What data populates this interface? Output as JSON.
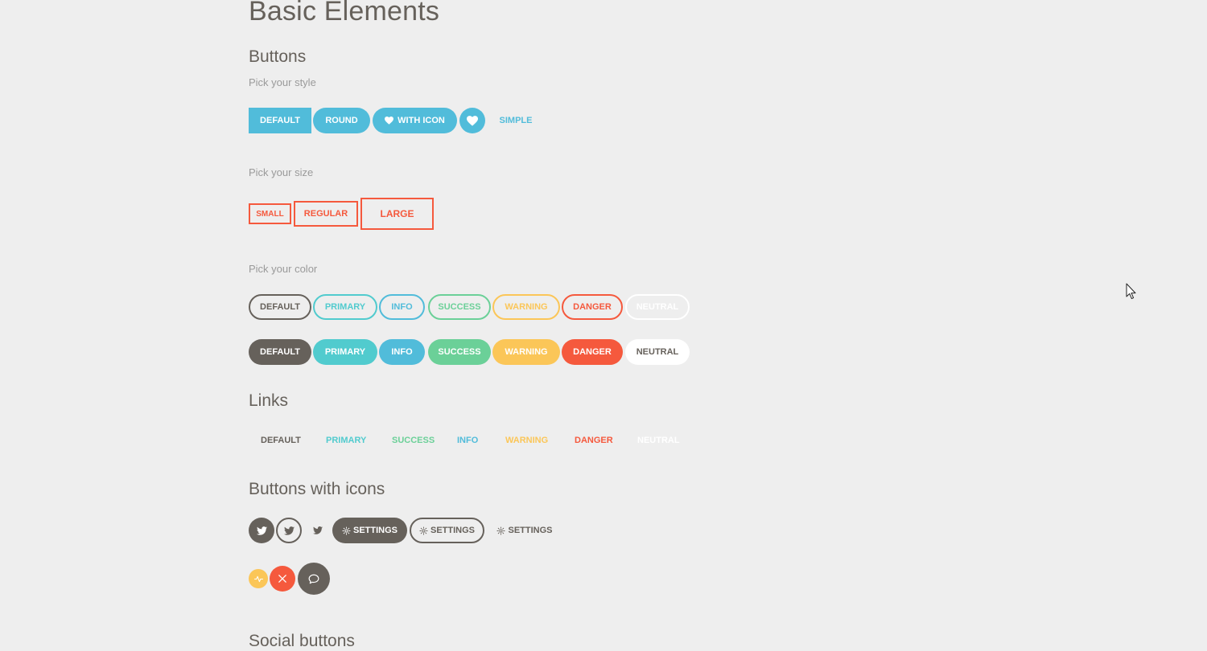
{
  "page_title": "Basic Elements",
  "buttons": {
    "heading": "Buttons",
    "style": {
      "label": "Pick your style",
      "default": "DEFAULT",
      "round": "ROUND",
      "with_icon": "WITH ICON",
      "simple": "SIMPLE"
    },
    "size": {
      "label": "Pick your size",
      "small": "SMALL",
      "regular": "REGULAR",
      "large": "LARGE"
    },
    "color": {
      "label": "Pick your color",
      "outline": [
        "DEFAULT",
        "PRIMARY",
        "INFO",
        "SUCCESS",
        "WARNING",
        "DANGER",
        "NEUTRAL"
      ],
      "filled": [
        "DEFAULT",
        "PRIMARY",
        "INFO",
        "SUCCESS",
        "WARNING",
        "DANGER",
        "NEUTRAL"
      ]
    }
  },
  "links": {
    "heading": "Links",
    "items": [
      "DEFAULT",
      "PRIMARY",
      "SUCCESS",
      "INFO",
      "WARNING",
      "DANGER",
      "NEUTRAL"
    ]
  },
  "buttons_with_icons": {
    "heading": "Buttons with icons",
    "settings_label": "SETTINGS",
    "icons": [
      "twitter-icon",
      "gear-icon",
      "activity-icon",
      "close-icon",
      "chat-icon"
    ]
  },
  "social": {
    "heading": "Social buttons"
  },
  "colors": {
    "default": "#66615b",
    "primary": "#51cbce",
    "info": "#51bcda",
    "success": "#6bd098",
    "warning": "#fbc658",
    "danger": "#f5593d",
    "neutral": "#ffffff",
    "background": "#eeeeee"
  }
}
